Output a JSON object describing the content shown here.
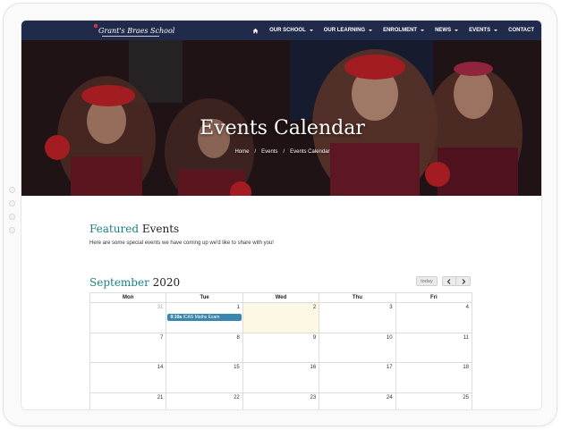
{
  "site": {
    "logo_text": "Grant's Braes School"
  },
  "nav": {
    "home_icon": "home-icon",
    "items": [
      {
        "label": "OUR SCHOOL",
        "dropdown": true
      },
      {
        "label": "OUR LEARNING",
        "dropdown": true
      },
      {
        "label": "ENROLMENT",
        "dropdown": true
      },
      {
        "label": "NEWS",
        "dropdown": true
      },
      {
        "label": "EVENTS",
        "dropdown": true
      },
      {
        "label": "CONTACT",
        "dropdown": false
      }
    ]
  },
  "hero": {
    "title": "Events Calendar",
    "breadcrumb": [
      "Home",
      "Events",
      "Events Calendar"
    ],
    "breadcrumb_separator": "/"
  },
  "featured": {
    "heading_accent": "Featured",
    "heading_rest": "Events",
    "intro": "Here are some special events we have coming up we'd like to share with you!"
  },
  "calendar": {
    "month": "September",
    "year": "2020",
    "today_label": "today",
    "prev_icon": "chevron-left-icon",
    "next_icon": "chevron-right-icon",
    "weekdays": [
      "Mon",
      "Tue",
      "Wed",
      "Thu",
      "Fri"
    ],
    "weeks": [
      [
        {
          "day": "31",
          "muted": true
        },
        {
          "day": "1"
        },
        {
          "day": "2",
          "today": true
        },
        {
          "day": "3"
        },
        {
          "day": "4"
        }
      ],
      [
        {
          "day": "7"
        },
        {
          "day": "8"
        },
        {
          "day": "9"
        },
        {
          "day": "10"
        },
        {
          "day": "11"
        }
      ],
      [
        {
          "day": "14"
        },
        {
          "day": "15"
        },
        {
          "day": "16"
        },
        {
          "day": "17"
        },
        {
          "day": "18"
        }
      ],
      [
        {
          "day": "21"
        },
        {
          "day": "22"
        },
        {
          "day": "23"
        },
        {
          "day": "24"
        },
        {
          "day": "25"
        }
      ]
    ],
    "events": [
      {
        "week": 0,
        "col": 0,
        "time": "9:10a",
        "title": "ICAS Maths Exam"
      }
    ]
  },
  "colors": {
    "navbar": "#202b4c",
    "accent_teal": "#1c7f82",
    "event_blue": "#3a87ad",
    "today_bg": "#fcf8e3"
  }
}
